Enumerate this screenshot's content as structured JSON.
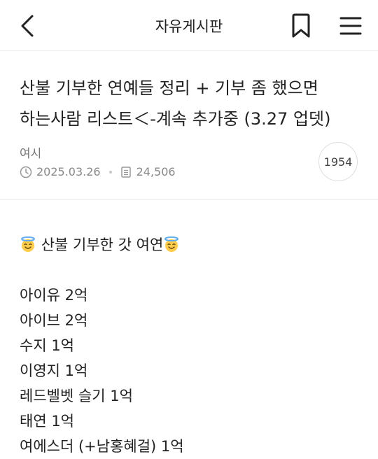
{
  "header": {
    "title": "자유게시판",
    "back_icon": "chevron-left-icon",
    "bookmark_icon": "bookmark-icon",
    "menu_icon": "hamburger-menu-icon"
  },
  "post": {
    "title_line1": "산불 기부한 연예들 정리 + 기부 좀 했으면",
    "title_line2": "하는사람 리스트＜-계속 추가중 (3.27 업뎃)",
    "author": "여시",
    "date": "2025.03.26",
    "views": "24,506",
    "comments": "1954"
  },
  "content": {
    "heading": "산불 기부한 갓 여연",
    "heading_emoji": "smiling-face-with-halo",
    "lines": [
      "아이유 2억",
      "아이브 2억",
      "수지 1억",
      "이영지 1억",
      "레드벨벳 슬기 1억",
      "태연 1억",
      "여에스더 (+남홍혜걸) 1억"
    ]
  }
}
